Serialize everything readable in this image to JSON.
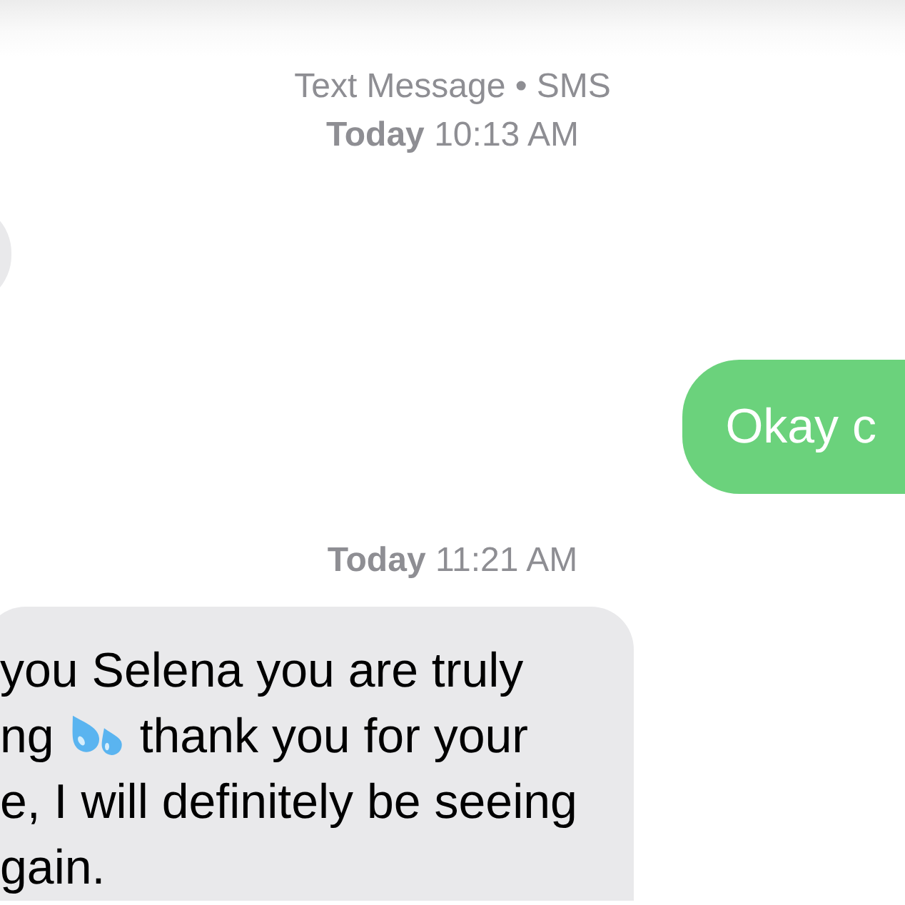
{
  "header": {
    "service": "Text Message • SMS",
    "timestamp": "**Today** 10:13 AM"
  },
  "conversation": [
    {
      "kind": "bubble",
      "outgoing": false
    },
    {
      "kind": "bubble",
      "outgoing": true,
      "lines": [
        [
          {
            "kind": "text",
            "text": "Okay c"
          }
        ]
      ]
    },
    {
      "kind": "timestamp",
      "text": "**Today** 11:21 AM"
    },
    {
      "kind": "bubble",
      "outgoing": false,
      "lines": [
        [
          {
            "kind": "text",
            "text": "you Selena you are truly"
          }
        ],
        [
          {
            "kind": "text",
            "text": "ng"
          },
          {
            "kind": "icon"
          },
          {
            "kind": "text",
            "text": "thank you for your"
          }
        ],
        [
          {
            "kind": "text",
            "text": "e, I will definitely be seeing"
          }
        ],
        [
          {
            "kind": "text",
            "text": "gain."
          }
        ]
      ]
    }
  ]
}
